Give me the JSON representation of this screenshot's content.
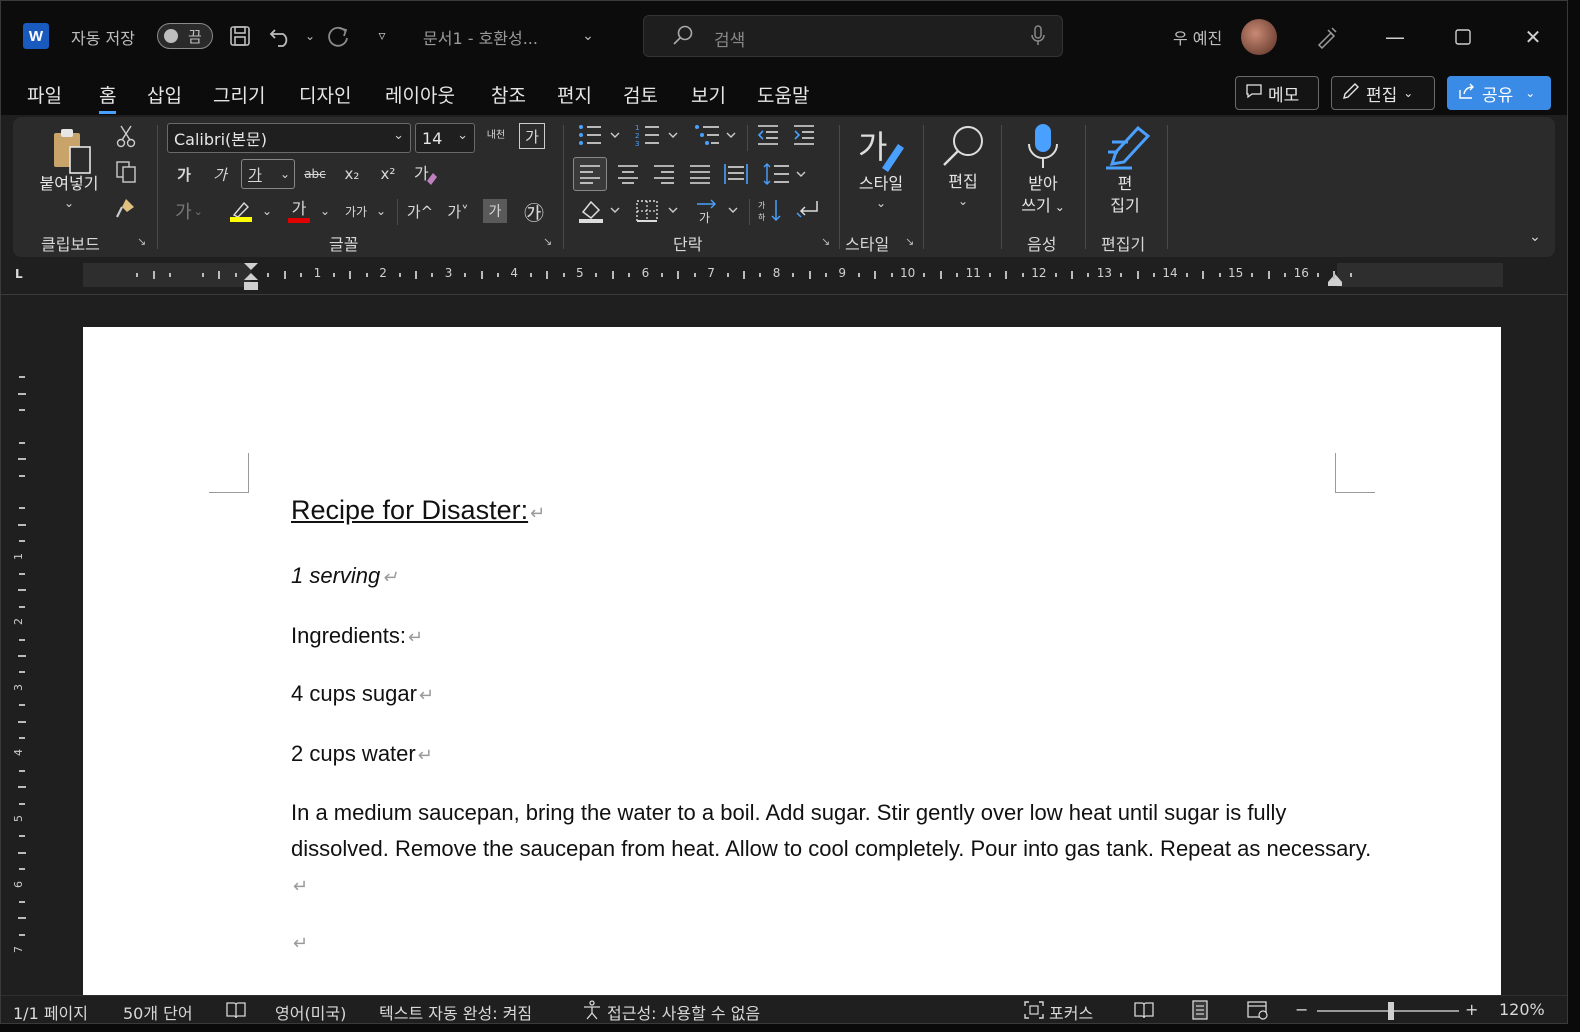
{
  "titlebar": {
    "app_icon": "W",
    "autosave_label": "자동 저장",
    "autosave_state": "끔",
    "doc_title": "문서1  -  호환성...",
    "search_placeholder": "검색",
    "user_name": "우 예진"
  },
  "menu": {
    "tabs": [
      "파일",
      "홈",
      "삽입",
      "그리기",
      "디자인",
      "레이아웃",
      "참조",
      "편지",
      "검토",
      "보기",
      "도움말"
    ],
    "active_tab": "홈",
    "memo_label": "메모",
    "edit_label": "편집",
    "share_label": "공유",
    "accent_color": "#3a8be6"
  },
  "ribbon": {
    "clipboard": {
      "paste_label": "붙여넣기",
      "group_label": "클립보드"
    },
    "font": {
      "font_name": "Calibri(본문)",
      "font_size": "14",
      "group_label": "글꼴",
      "bold": "가",
      "italic": "가",
      "underline": "가",
      "strike": "abc",
      "subscript": "x₂",
      "superscript": "x²",
      "grow": "가^",
      "shrink": "가˅",
      "change_case": "가가",
      "enclose": "㉮",
      "shade": "가",
      "font_color_letter": "가",
      "highlight_color": "#ffff00",
      "font_color": "#e00000"
    },
    "paragraph": {
      "group_label": "단락"
    },
    "styles": {
      "label": "스타일",
      "group_label": "스타일"
    },
    "editing": {
      "label": "편집"
    },
    "voice": {
      "label_line1": "받아",
      "label_line2": "쓰기",
      "group_label": "음성"
    },
    "editor": {
      "label_line1": "편",
      "label_line2": "집기",
      "group_label": "편집기"
    },
    "hangul_label": "내천"
  },
  "ruler": {
    "numbers": [
      "1",
      "2",
      "3",
      "4",
      "5",
      "6",
      "7",
      "8",
      "9",
      "10",
      "11",
      "12",
      "13",
      "14",
      "15",
      "16"
    ],
    "vertical_numbers": [
      "1",
      "2",
      "3",
      "4",
      "5",
      "6",
      "7"
    ]
  },
  "document": {
    "title": "Recipe for Disaster:",
    "serving": "1 serving",
    "ingredients_heading": "Ingredients:",
    "ingredient_1": "4 cups sugar",
    "ingredient_2": "2 cups water",
    "instructions": "In a medium saucepan, bring the water to a boil. Add sugar. Stir gently over low heat until sugar is fully dissolved. Remove  the  saucepan from heat.  Allow to cool completely. Pour into gas tank. Repeat as necessary. ",
    "pilcrow": "↵"
  },
  "statusbar": {
    "page": "1/1 페이지",
    "words": "50개 단어",
    "language": "영어(미국)",
    "autocomplete": "텍스트 자동 완성: 켜짐",
    "accessibility": "접근성: 사용할 수 없음",
    "focus": "포커스",
    "zoom": "120%"
  }
}
